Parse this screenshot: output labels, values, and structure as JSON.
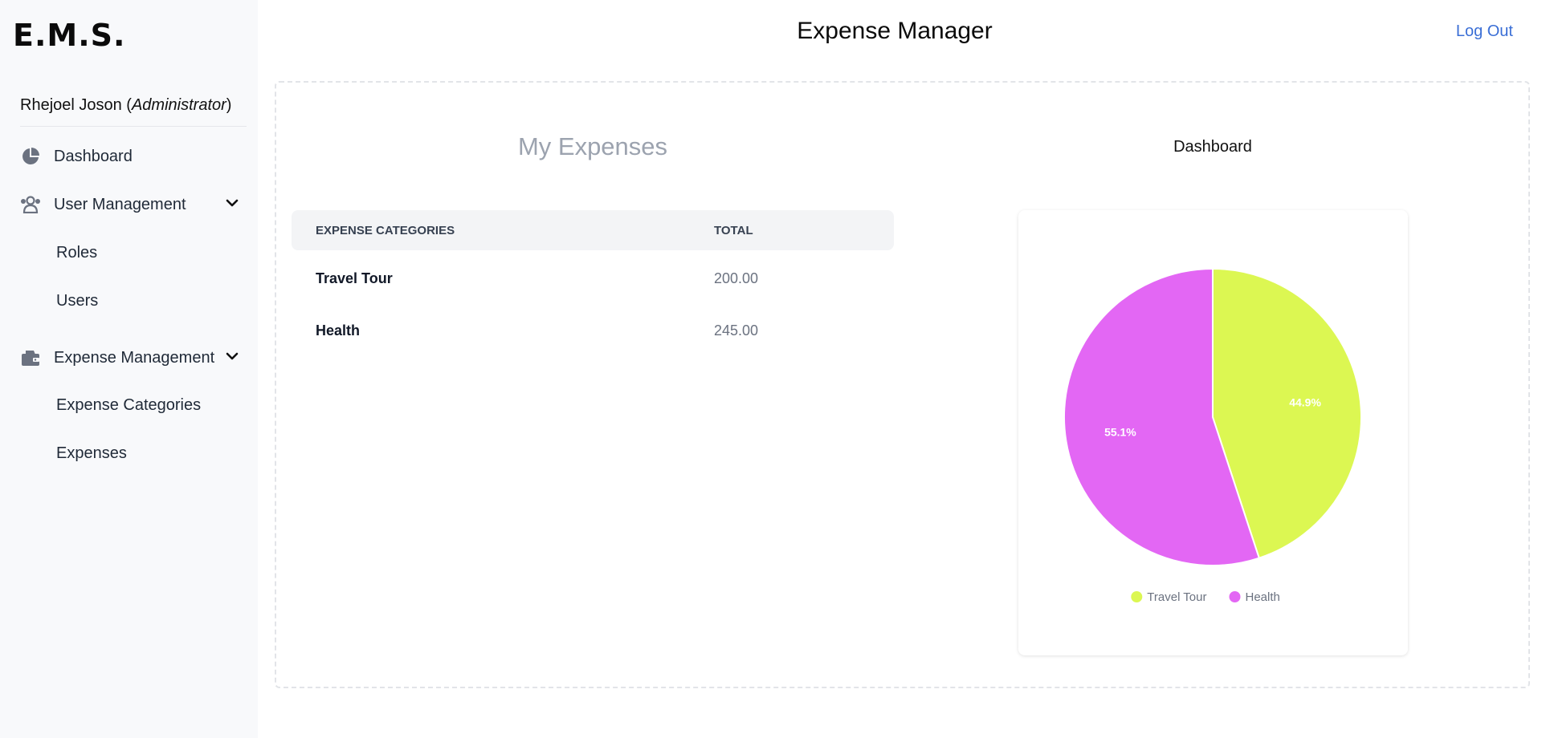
{
  "sidebar": {
    "brand": "E.M.S.",
    "user_name": "Rhejoel Joson",
    "user_role": "Administrator",
    "items": [
      {
        "label": "Dashboard",
        "icon": "pie-chart-icon"
      },
      {
        "label": "User Management",
        "icon": "users-icon",
        "expanded": true,
        "children": [
          {
            "label": "Roles"
          },
          {
            "label": "Users"
          }
        ]
      },
      {
        "label": "Expense Management",
        "icon": "wallet-icon",
        "expanded": true,
        "children": [
          {
            "label": "Expense Categories"
          },
          {
            "label": "Expenses"
          }
        ]
      }
    ]
  },
  "header": {
    "title": "Expense Manager",
    "logout_label": "Log Out",
    "logout_color": "#3b6fd6"
  },
  "main": {
    "section_title": "My Expenses",
    "table": {
      "columns": [
        "EXPENSE CATEGORIES",
        "TOTAL"
      ],
      "rows": [
        {
          "category": "Travel Tour",
          "total": "200.00"
        },
        {
          "category": "Health",
          "total": "245.00"
        }
      ]
    },
    "dashboard_title": "Dashboard"
  },
  "chart_data": {
    "type": "pie",
    "categories": [
      "Travel Tour",
      "Health"
    ],
    "values": [
      200.0,
      245.0
    ],
    "percent_labels": [
      "44.9%",
      "55.1%"
    ],
    "colors": [
      "#dcf752",
      "#e367f4"
    ],
    "legend": "bottom"
  }
}
